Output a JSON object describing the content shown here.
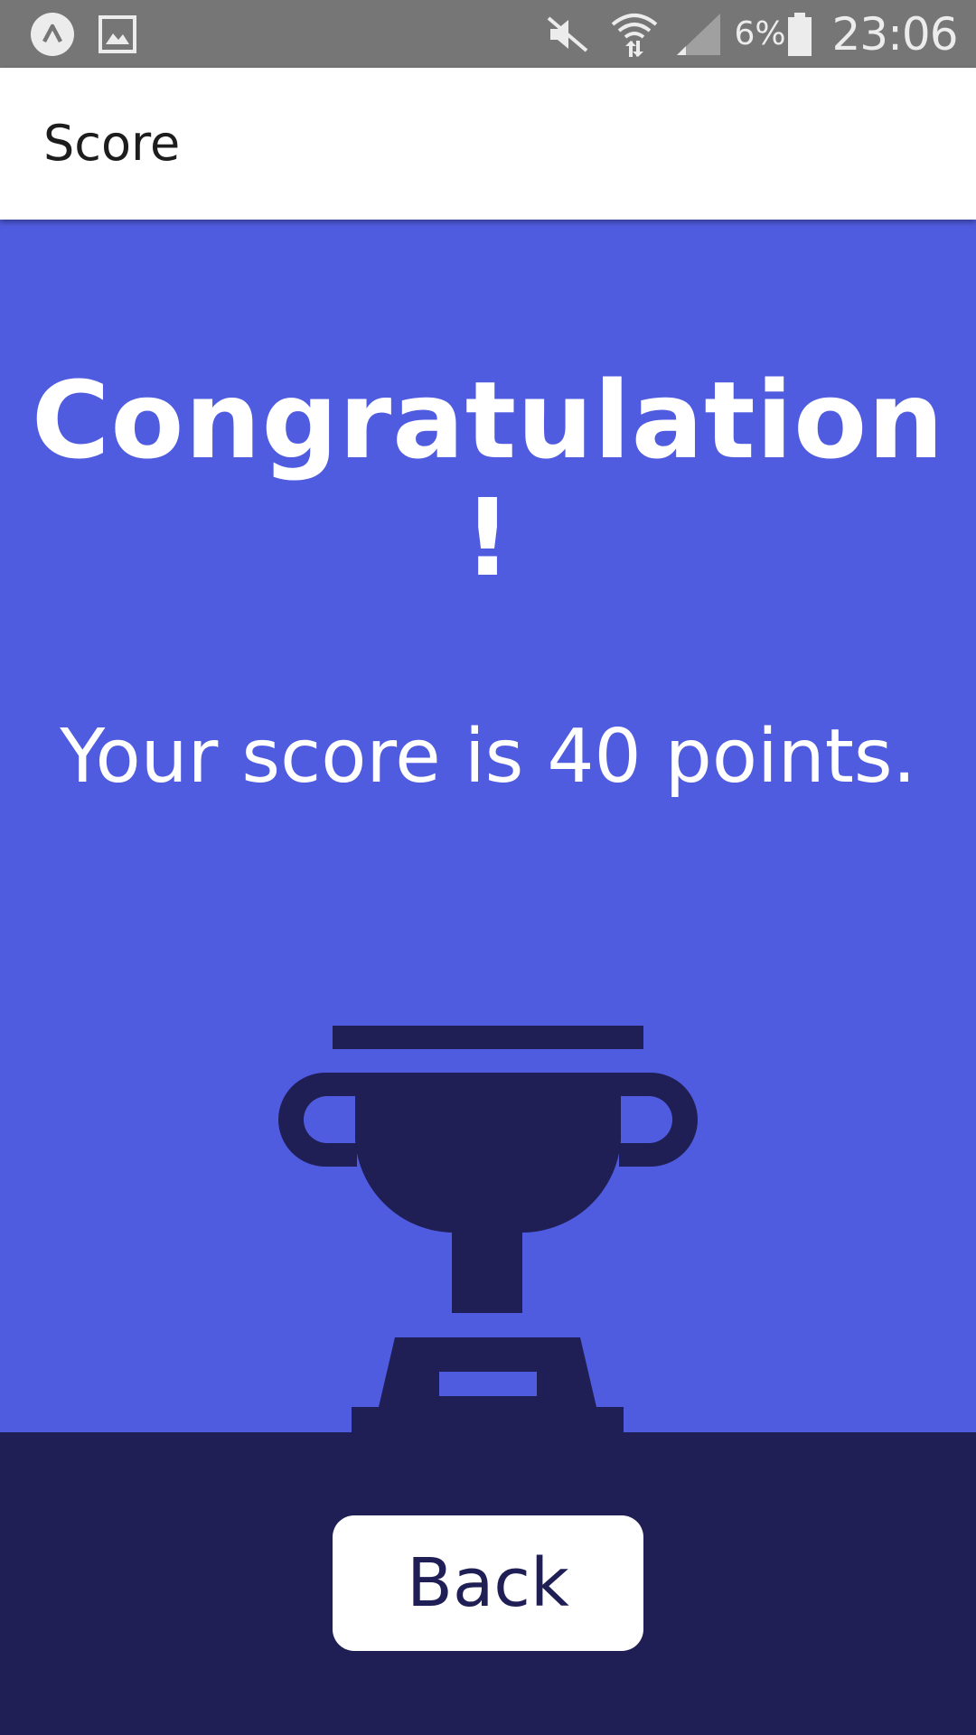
{
  "status_bar": {
    "icons": [
      "app-launcher-icon",
      "gallery-icon",
      "mute-icon",
      "wifi-icon",
      "signal-icon",
      "battery-icon"
    ],
    "battery_percent": "6%",
    "time": "23:06"
  },
  "app_bar": {
    "title": "Score"
  },
  "main": {
    "heading": "Congratulation !",
    "score_message": "Your score is 40 points.",
    "illustration_icon": "trophy-icon"
  },
  "footer": {
    "back_label": "Back"
  },
  "colors": {
    "status_bar": "#767676",
    "app_bar": "#ffffff",
    "background": "#505ce0",
    "dark": "#1f1f56",
    "text_light": "#ffffff"
  }
}
